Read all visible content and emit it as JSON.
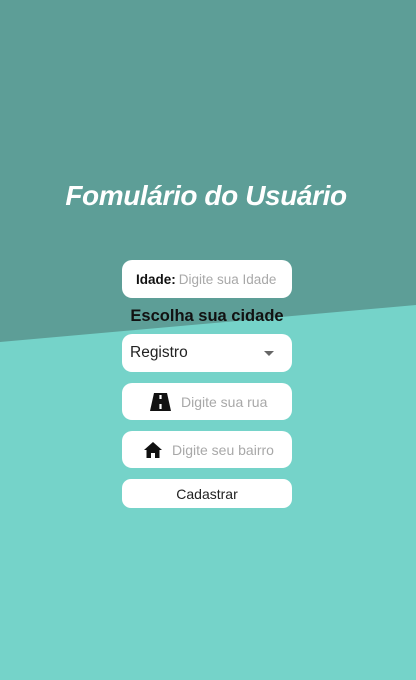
{
  "form": {
    "title": "Fomulário do Usuário",
    "age": {
      "label": "Idade:",
      "placeholder": "Digite sua Idade"
    },
    "city": {
      "label": "Escolha sua cidade",
      "selected": "Registro",
      "icon": "chevron-down-icon"
    },
    "street": {
      "placeholder": "Digite sua rua",
      "icon": "road-icon"
    },
    "district": {
      "placeholder": "Digite seu bairro",
      "icon": "home-icon"
    },
    "submit_label": "Cadastrar"
  },
  "colors": {
    "background": "#75d3c9",
    "header_shape": "#5d9e97",
    "field": "#ffffff",
    "status_bar": "#111111"
  }
}
